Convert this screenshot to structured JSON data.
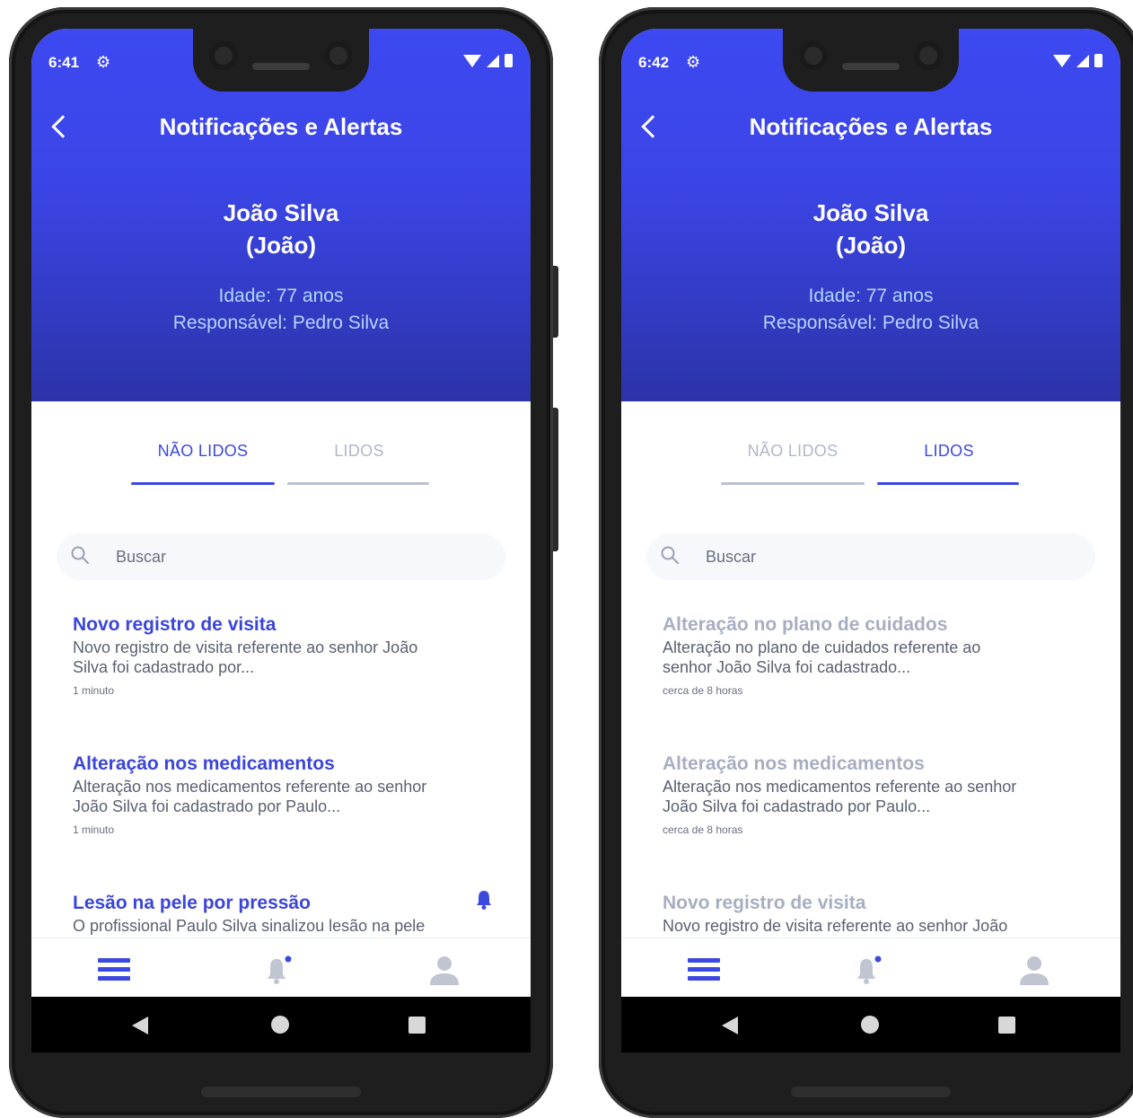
{
  "phones": [
    {
      "status": {
        "time": "6:41"
      },
      "header": {
        "title": "Notificações e Alertas",
        "name": "João Silva",
        "nickname": "(João)",
        "age": "Idade: 77 anos",
        "responsible": "Responsável: Pedro Silva"
      },
      "tabs": [
        {
          "label": "NÃO LIDOS",
          "active": true
        },
        {
          "label": "LIDOS",
          "active": false
        }
      ],
      "search": {
        "placeholder": "Buscar"
      },
      "notifications": [
        {
          "title": "Novo registro de visita",
          "body_line1": "Novo registro de visita referente ao senhor João",
          "body_line2": "Silva foi cadastrado por...",
          "time": "1 minuto"
        },
        {
          "title": "Alteração nos medicamentos",
          "body_line1": "Alteração nos medicamentos referente ao senhor",
          "body_line2": "João Silva foi cadastrado por Paulo...",
          "time": "1 minuto"
        },
        {
          "title": "Lesão na pele por pressão",
          "body_line1": "O profissional Paulo Silva sinalizou lesão na pele",
          "body_line2": "",
          "time": ""
        }
      ]
    },
    {
      "status": {
        "time": "6:42"
      },
      "header": {
        "title": "Notificações e Alertas",
        "name": "João Silva",
        "nickname": "(João)",
        "age": "Idade: 77 anos",
        "responsible": "Responsável: Pedro Silva"
      },
      "tabs": [
        {
          "label": "NÃO LIDOS",
          "active": false
        },
        {
          "label": "LIDOS",
          "active": true
        }
      ],
      "search": {
        "placeholder": "Buscar"
      },
      "notifications": [
        {
          "title": "Alteração no plano de cuidados",
          "body_line1": "Alteração no plano de cuidados referente ao",
          "body_line2": "senhor João Silva foi cadastrado...",
          "time": "cerca de 8 horas"
        },
        {
          "title": "Alteração nos medicamentos",
          "body_line1": "Alteração nos medicamentos referente ao senhor",
          "body_line2": "João Silva foi cadastrado por Paulo...",
          "time": "cerca de 8 horas"
        },
        {
          "title": "Novo registro de visita",
          "body_line1": "Novo registro de visita referente ao senhor João",
          "body_line2": "",
          "time": ""
        }
      ]
    }
  ],
  "colors": {
    "header_top": "#3d49f1",
    "header_bottom": "#2c33a8",
    "accent": "#3c49e0",
    "unread_title": "#3b45d9",
    "read_title": "#a8aec2",
    "subtitle_text": "#b5d4ff"
  },
  "icons": {
    "status": [
      "settings-gear-icon",
      "wifi-icon",
      "cellular-signal-icon",
      "battery-icon"
    ],
    "header": "back-arrow-icon",
    "search": "search-icon",
    "alert": "bell-icon",
    "bottom_nav": [
      "menu-icon",
      "bell-icon",
      "user-icon"
    ],
    "system_nav": [
      "back-triangle-icon",
      "home-circle-icon",
      "recent-apps-square-icon"
    ]
  }
}
